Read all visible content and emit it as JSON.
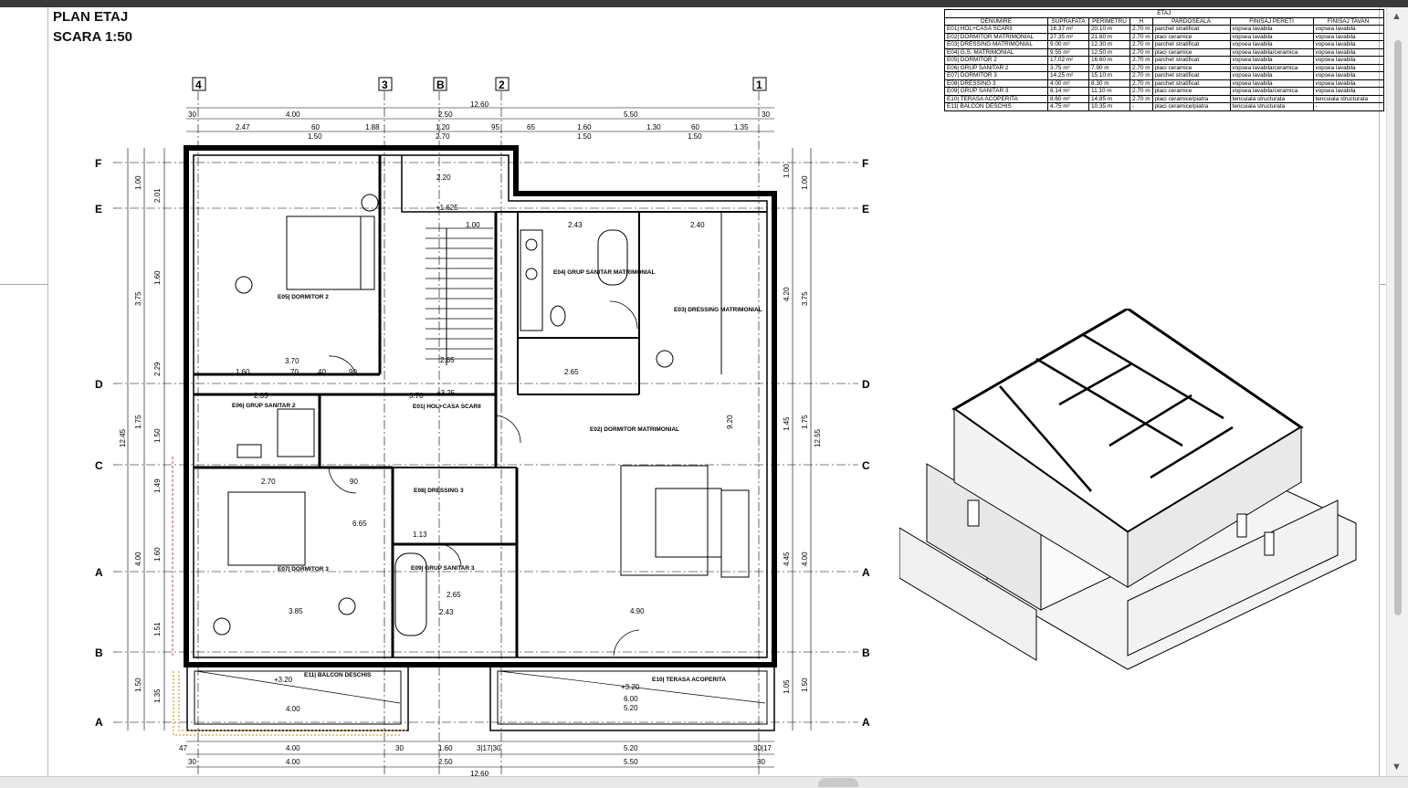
{
  "header": {
    "title": "PLAN ETAJ",
    "subtitle": "SCARA 1:50"
  },
  "room_table": {
    "group_header": "ETAJ",
    "columns": [
      "DENUMIRE",
      "SUPRAFATA",
      "PERIMETRU",
      "H",
      "PARDOSEALA",
      "FINISAJ PERETI",
      "FINISAJ TAVAN"
    ],
    "rows": [
      [
        "E01| HOL+CASA SCARII",
        "16.37 m²",
        "20.10 m",
        "2.70 m",
        "parchet stratificat",
        "vopsea lavabila",
        "vopsea lavabila"
      ],
      [
        "E02| DORMITOR MATRIMONIAL",
        "27.35 m²",
        "21.60 m",
        "2.70 m",
        "placi ceramice",
        "vopsea lavabila",
        "vopsea lavabila"
      ],
      [
        "E03| DRESSING MATRIMONIAL",
        "9.00 m²",
        "12.30 m",
        "2.70 m",
        "parchet stratificat",
        "vopsea lavabila",
        "vopsea lavabila"
      ],
      [
        "E04| G.S. MATRIMONIAL",
        "9.55 m²",
        "12.50 m",
        "2.70 m",
        "placi ceramice",
        "vopsea lavabila/ceramica",
        "vopsea lavabila"
      ],
      [
        "E05| DORMITOR 2",
        "17.02 m²",
        "16.60 m",
        "2.70 m",
        "parchet stratificat",
        "vopsea lavabila",
        "vopsea lavabila"
      ],
      [
        "E06| GRUP SANITAR 2",
        "3.75 m²",
        "7.90 m",
        "2.70 m",
        "placi ceramice",
        "vopsea lavabila/ceramica",
        "vopsea lavabila"
      ],
      [
        "E07| DORMITOR 3",
        "14.25 m²",
        "15.10 m",
        "2.70 m",
        "parchet stratificat",
        "vopsea lavabila",
        "vopsea lavabila"
      ],
      [
        "E08| DRESSING 3",
        "4.00 m²",
        "8.30 m",
        "2.70 m",
        "parchet stratificat",
        "vopsea lavabila",
        "vopsea lavabila"
      ],
      [
        "E09| GRUP SANITAR 3",
        "8.14 m²",
        "11.10 m",
        "2.70 m",
        "placi ceramice",
        "vopsea lavabila/ceramica",
        "vopsea lavabila"
      ],
      [
        "E10| TERASA ACOPERITA",
        "8.60 m²",
        "14.85 m",
        "2.70 m",
        "placi ceramice/piatra",
        "tencuiala structurata",
        "tencuiala structurata"
      ],
      [
        "E11| BALCON DESCHIS",
        "4.75 m²",
        "10.35 m",
        "-",
        "placi ceramice/piatra",
        "tencuiala structurata",
        "-"
      ]
    ]
  },
  "axes": {
    "columns": [
      "4",
      "3",
      "B",
      "2",
      "1"
    ],
    "rows": [
      "F",
      "E",
      "D",
      "C",
      "A",
      "B",
      "A"
    ],
    "side_rows_right": [
      "F",
      "E",
      "D",
      "C",
      "A",
      "B",
      "A"
    ]
  },
  "dims": {
    "top_total": "12.60",
    "top_row1": [
      "30",
      "4.00",
      "2.50",
      "5.50",
      "30"
    ],
    "top_row2": [
      "2.47",
      "60",
      "1.88",
      "1.20",
      "95",
      "65",
      "1.60",
      "1.30",
      "60",
      "1.35"
    ],
    "top_row2b": [
      "1.50",
      "2.70",
      "1.50",
      "1.50"
    ],
    "bottom_row1": [
      "47",
      "4.00",
      "30",
      "1.60",
      "3|17|30",
      "5.20",
      "30|17"
    ],
    "bottom_row2": [
      "30",
      "4.00",
      "2.50",
      "5.50",
      "30"
    ],
    "bottom_total": "12.60",
    "left_total": "12.45",
    "left_col": [
      "1.00",
      "3.75",
      "1.75",
      "4.00",
      "1.50"
    ],
    "left_col2": [
      "2.01",
      "1.60",
      "2.29",
      "1.50",
      "1.49",
      "1.60",
      "1.51",
      "1.35"
    ],
    "right_total": "12.55",
    "right_col": [
      "1.00",
      "3.75",
      "1.75",
      "4.00",
      "1.50"
    ],
    "right_col2": [
      "1.00",
      "4.20",
      "1.45",
      "4.45",
      "1.05"
    ]
  },
  "rooms": [
    {
      "code": "E01| HOL+CASA SCARII",
      "level": "+3.25"
    },
    {
      "code": "E02| DORMITOR MATRIMONIAL",
      "dim": "4.90"
    },
    {
      "code": "E03| DRESSING MATRIMONIAL",
      "dim": "2.40"
    },
    {
      "code": "E04| GRUP SANITAR MATRIMONIAL",
      "dim": "2.43"
    },
    {
      "code": "E05| DORMITOR 2",
      "dim": "3.70"
    },
    {
      "code": "E06| GRUP SANITAR 2",
      "dim": "2.35"
    },
    {
      "code": "E07| DORMITOR 3",
      "dim": "3.85"
    },
    {
      "code": "E08| DRESSING 3",
      "dim": "1.13"
    },
    {
      "code": "E09| GRUP SANITAR 3",
      "dim": "2.43"
    },
    {
      "code": "E10| TERASA ACOPERITA",
      "level": "+3.20",
      "dim": "6.00"
    },
    {
      "code": "E11| BALCON DESCHIS",
      "level": "+3.20",
      "dim": "4.00"
    }
  ],
  "misc_labels": {
    "stair_level": "+1.625",
    "interior_dims": [
      "2.20",
      "1.00",
      "2.43",
      "2.65",
      "3.70",
      "1.60",
      "70",
      "40",
      "90",
      "6.65",
      "2.70",
      "90",
      "2.65",
      "5.20",
      "9.20",
      "2.65"
    ]
  }
}
